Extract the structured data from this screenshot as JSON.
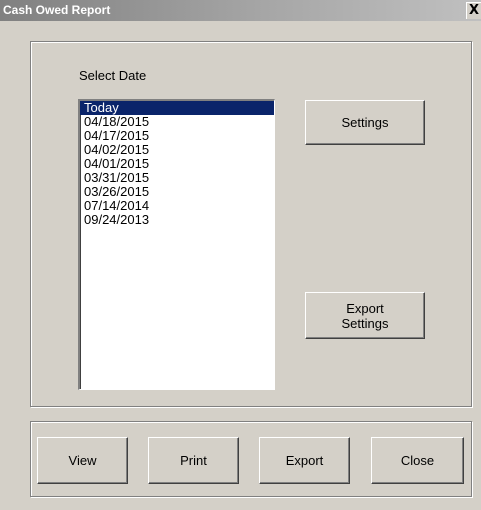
{
  "window": {
    "title": "Cash Owed Report",
    "close_label": "X"
  },
  "date_selector": {
    "label": "Select Date",
    "items": [
      {
        "label": "Today",
        "selected": true
      },
      {
        "label": "04/18/2015",
        "selected": false
      },
      {
        "label": "04/17/2015",
        "selected": false
      },
      {
        "label": "04/02/2015",
        "selected": false
      },
      {
        "label": "04/01/2015",
        "selected": false
      },
      {
        "label": "03/31/2015",
        "selected": false
      },
      {
        "label": "03/26/2015",
        "selected": false
      },
      {
        "label": "07/14/2014",
        "selected": false
      },
      {
        "label": "09/24/2013",
        "selected": false
      }
    ]
  },
  "side_buttons": {
    "settings": "Settings",
    "export_settings": "Export\nSettings"
  },
  "footer_buttons": {
    "view": "View",
    "print": "Print",
    "export": "Export",
    "close": "Close"
  },
  "colors": {
    "face": "#d4d0c8",
    "selection": "#0a246a",
    "title_gradient_start": "#808080"
  }
}
